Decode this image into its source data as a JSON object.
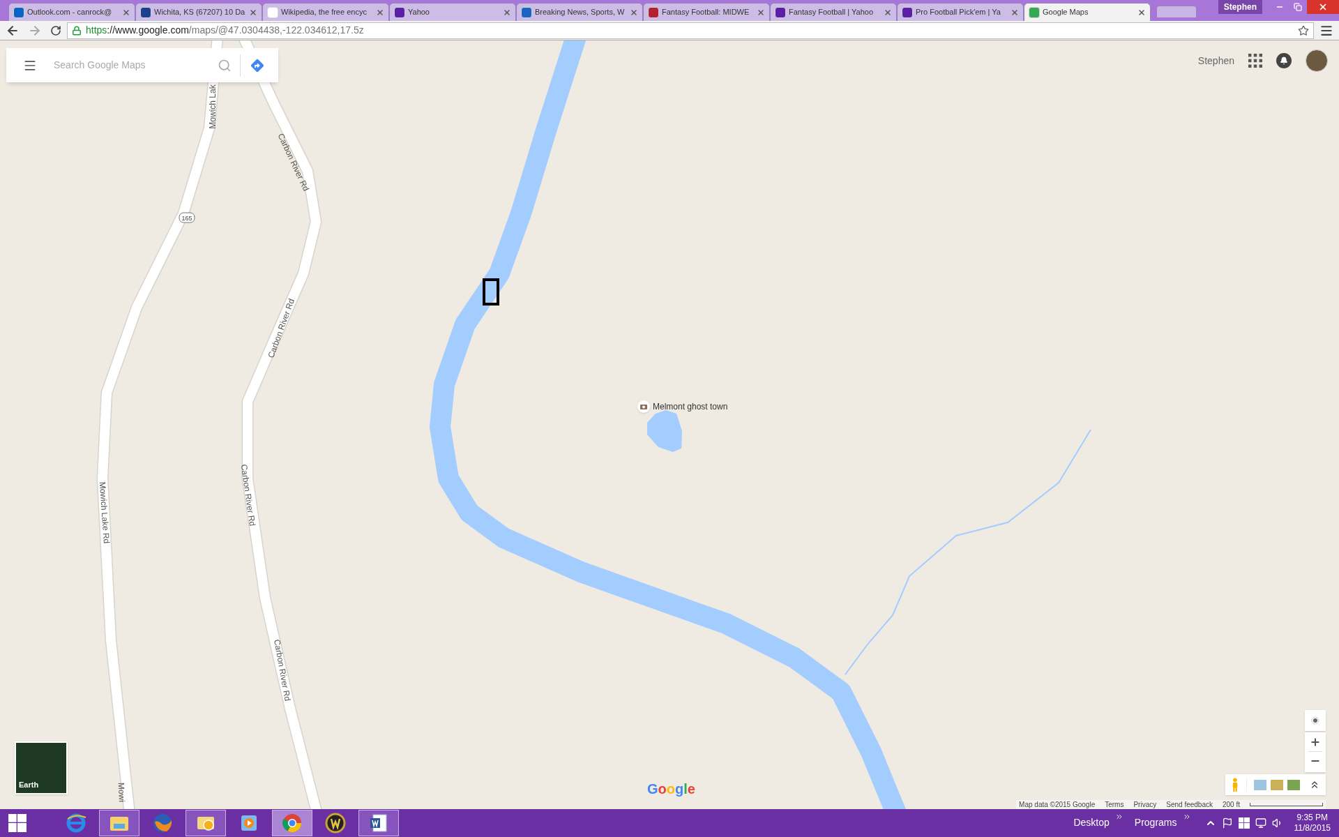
{
  "browser": {
    "profile": "Stephen",
    "tabs": [
      {
        "title": "Outlook.com - canrock@",
        "selected": false
      },
      {
        "title": "Wichita, KS (67207) 10 Da",
        "selected": false
      },
      {
        "title": "Wikipedia, the free encyc",
        "selected": false
      },
      {
        "title": "Yahoo",
        "selected": false
      },
      {
        "title": "Breaking News, Sports, W",
        "selected": false
      },
      {
        "title": "Fantasy Football: MIDWE",
        "selected": false
      },
      {
        "title": "Fantasy Football | Yahoo",
        "selected": false
      },
      {
        "title": "Pro Football Pick'em | Ya",
        "selected": false
      },
      {
        "title": "Google Maps",
        "selected": true
      }
    ],
    "url": {
      "scheme": "https",
      "host": "://www.google.com",
      "path": "/maps/@47.0304438,-122.034612,17.5z"
    }
  },
  "map": {
    "search": {
      "placeholder": "Search Google Maps"
    },
    "account": {
      "name": "Stephen"
    },
    "road_labels": [
      "Mowich Lak",
      "Carbon River Rd",
      "Carbon River Rd",
      "Carbon River Rd",
      "Mowich Lake Rd",
      "Carbon River Rd",
      "Mowi"
    ],
    "route_shield": "165",
    "place": {
      "name": "Melmont ghost town"
    },
    "layer_tile": {
      "label": "Earth"
    },
    "logo": "Google",
    "footer": {
      "items": [
        "Map data ©2015 Google",
        "Terms",
        "Privacy",
        "Send feedback"
      ],
      "scale": "200 ft"
    }
  },
  "taskbar": {
    "apps": [
      {
        "running": false,
        "selected": false
      },
      {
        "running": true,
        "selected": false
      },
      {
        "running": false,
        "selected": false
      },
      {
        "running": true,
        "selected": false
      },
      {
        "running": false,
        "selected": false
      },
      {
        "running": true,
        "selected": true
      },
      {
        "running": false,
        "selected": false
      },
      {
        "running": true,
        "selected": false
      }
    ],
    "toolbars": [
      "Desktop",
      "Programs"
    ],
    "time": "9:35 PM",
    "date": "11/8/2015"
  }
}
